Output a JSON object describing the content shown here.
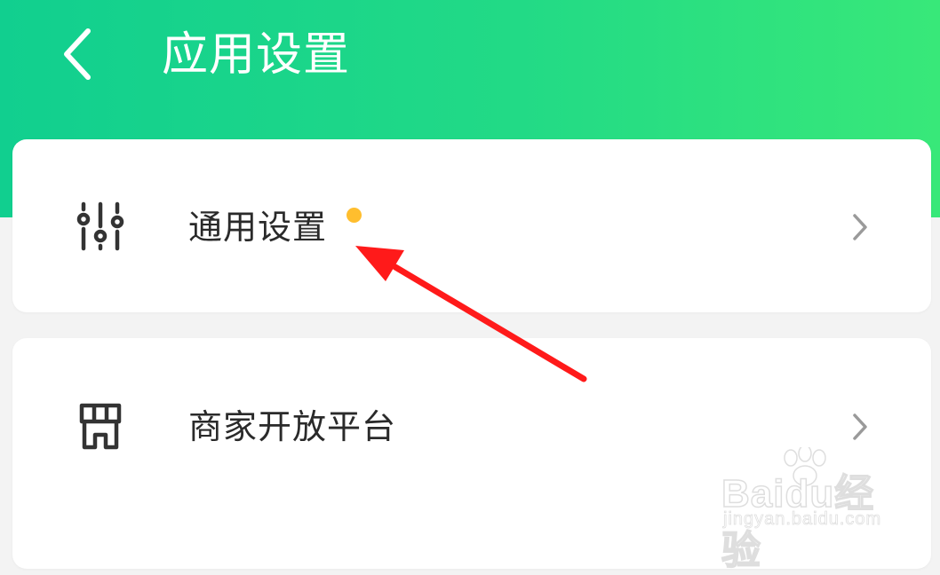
{
  "header": {
    "title": "应用设置",
    "back_icon": "chevron-left-icon",
    "gradient_start": "#11cf8f",
    "gradient_end": "#38e879"
  },
  "settings": [
    {
      "label": "通用设置",
      "icon": "sliders-icon",
      "has_badge_dot": true,
      "badge_color": "#ffbe2e",
      "trailing_icon": "chevron-right-icon"
    },
    {
      "label": "商家开放平台",
      "icon": "storefront-icon",
      "has_badge_dot": false,
      "trailing_icon": "chevron-right-icon"
    }
  ],
  "annotation": {
    "type": "arrow",
    "color": "#ff1a1a",
    "points_to": "通用设置"
  },
  "watermark": {
    "brand": "Baidu经验",
    "url": "jingyan.baidu.com"
  }
}
